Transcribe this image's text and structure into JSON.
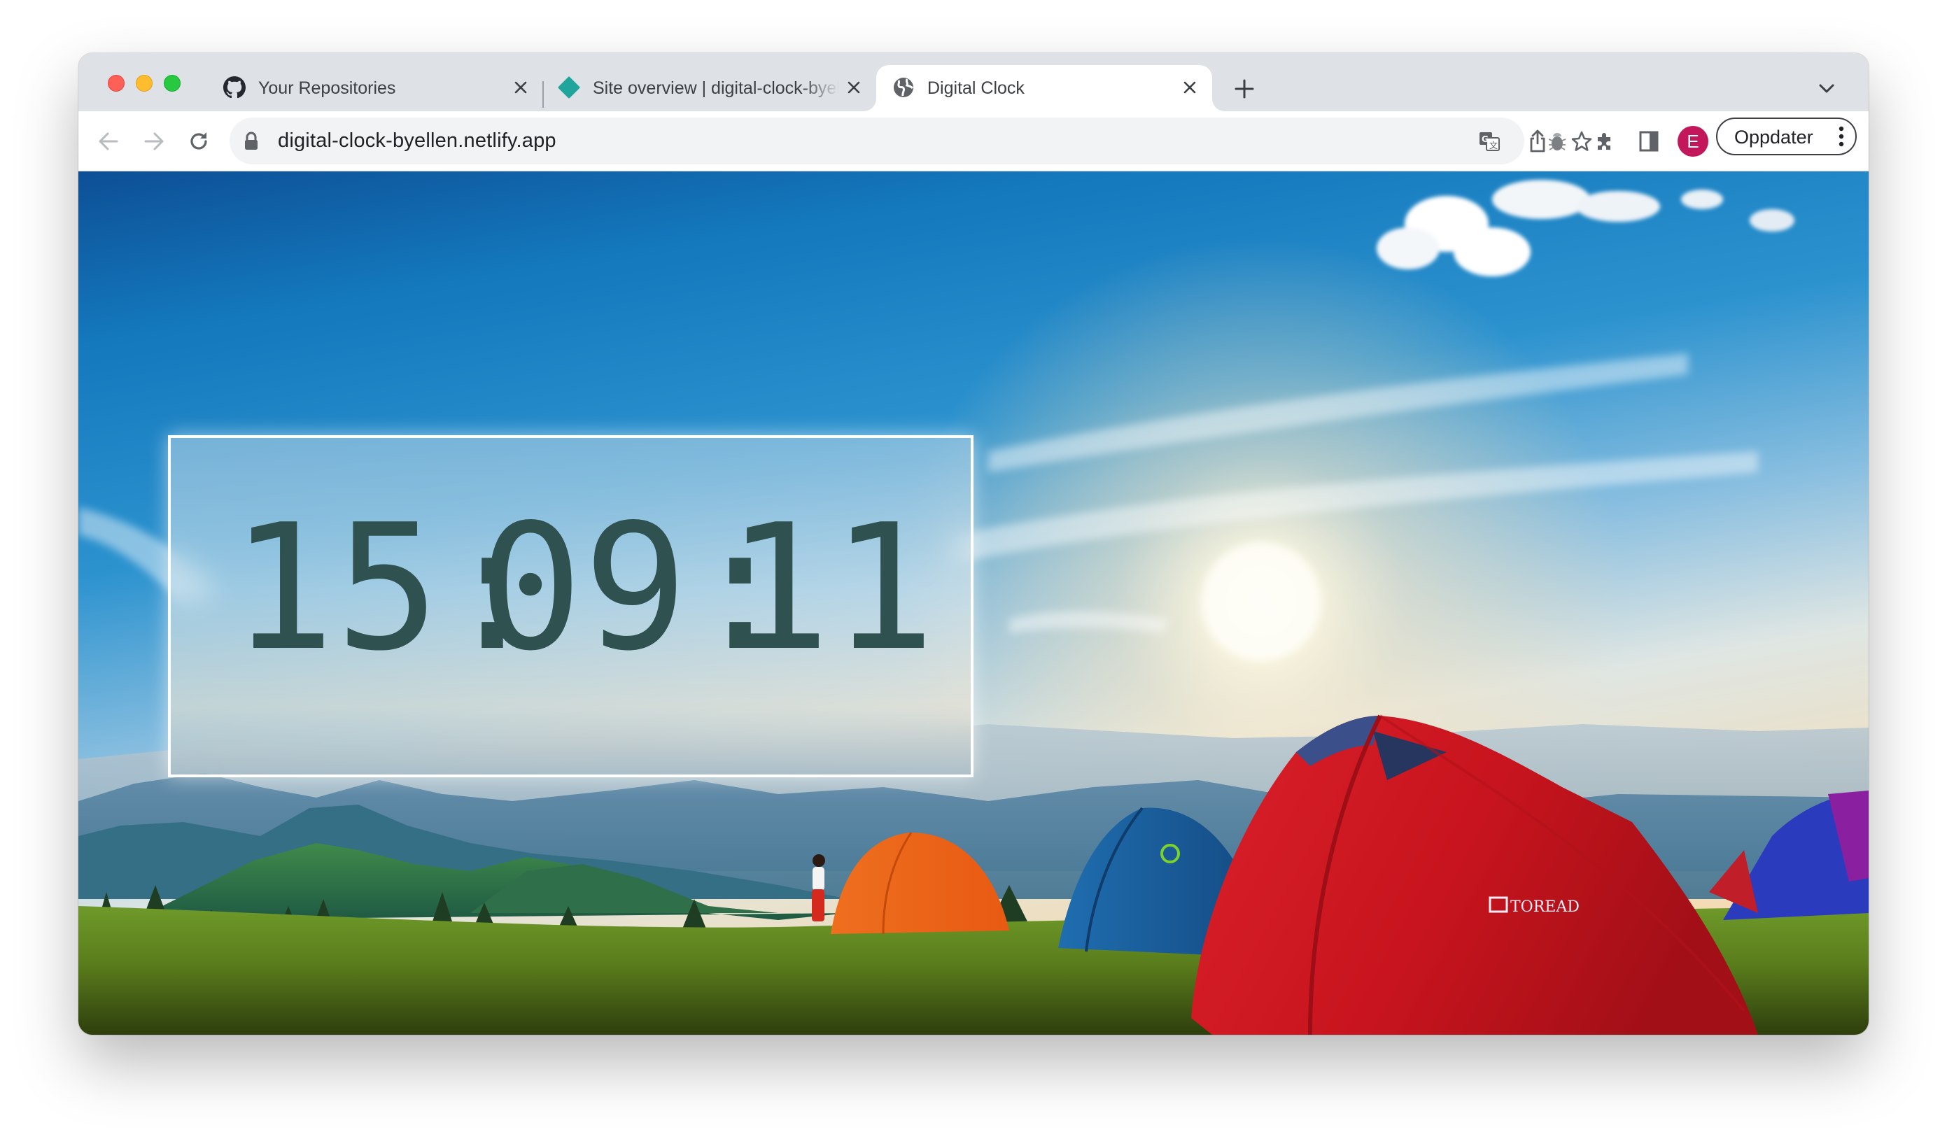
{
  "browser": {
    "tabs": [
      {
        "title": "Your Repositories",
        "icon": "github-icon",
        "active": false
      },
      {
        "title": "Site overview | digital-clock-byellen",
        "icon": "netlify-icon",
        "active": false
      },
      {
        "title": "Digital Clock",
        "icon": "globe-icon",
        "active": true
      }
    ],
    "new_tab_label": "+",
    "url": "digital-clock-byellen.netlify.app",
    "profile_initial": "E",
    "update_button_label": "Oppdater",
    "colors": {
      "tab_strip": "#dee1e6",
      "omnibox": "#f1f3f4",
      "avatar": "#c2185b",
      "netlify_favicon": "#1fa59c"
    }
  },
  "page": {
    "clock": {
      "time": "15:09:11",
      "chars": [
        "1",
        "5",
        ":",
        "0",
        "9",
        ":",
        "1",
        "1"
      ],
      "text_color": "#2f5150"
    },
    "background": {
      "description": "Campsite with tents on a grassy mountain top under a blue sky at sunrise",
      "tent_brand_text": "TOREAD"
    }
  }
}
